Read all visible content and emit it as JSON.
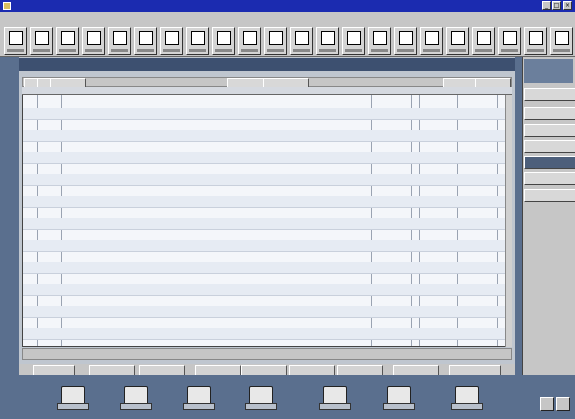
{
  "window": {
    "title": "",
    "min": "_",
    "max": "□",
    "close": "×"
  },
  "menu": [
    "",
    "",
    "",
    "",
    "",
    "",
    ""
  ],
  "toolbar": {
    "buttons": [
      {
        "icon": "new-icon"
      },
      {
        "icon": "open-icon"
      },
      {
        "icon": "register-icon"
      },
      {
        "icon": "write-checks-icon"
      },
      {
        "icon": "reports-icon"
      },
      {
        "icon": "print-icon"
      },
      {
        "icon": "calculator-icon"
      },
      {
        "icon": "bank-icon"
      },
      {
        "icon": "reconcile-icon"
      },
      {
        "icon": "accounts-icon"
      },
      {
        "icon": "invoices-icon"
      },
      {
        "icon": "payments-icon"
      },
      {
        "icon": "deposits-icon"
      },
      {
        "icon": "budget-icon"
      },
      {
        "icon": "graph-icon"
      },
      {
        "icon": "memorized-icon"
      },
      {
        "icon": "export-icon"
      },
      {
        "icon": "help-icon"
      },
      {
        "icon": "options-icon"
      },
      {
        "icon": "setup-icon"
      },
      {
        "icon": "backup-icon"
      },
      {
        "icon": "close-file-icon"
      }
    ]
  },
  "register": {
    "title": "",
    "header_buttons": [
      "",
      "",
      "",
      "",
      "",
      "",
      ""
    ],
    "columns": [
      "",
      "",
      "",
      "",
      "",
      "",
      ""
    ],
    "rows": [
      {
        "date": "",
        "num": "",
        "payee": "",
        "cat": "",
        "pay": "",
        "clr": "",
        "dep": "",
        "bal": ""
      },
      {
        "date": "",
        "num": "",
        "payee": "",
        "cat": "",
        "pay": "",
        "clr": "",
        "dep": "",
        "bal": ""
      },
      {
        "date": "",
        "num": "",
        "payee": "",
        "cat": "",
        "pay": "",
        "clr": "",
        "dep": "",
        "bal": ""
      },
      {
        "date": "",
        "num": "",
        "payee": "",
        "cat": "",
        "pay": "",
        "clr": "",
        "dep": "",
        "bal": ""
      },
      {
        "date": "",
        "num": "",
        "payee": "",
        "cat": "",
        "pay": "",
        "clr": "",
        "dep": "",
        "bal": ""
      },
      {
        "date": "",
        "num": "",
        "payee": "",
        "cat": "",
        "pay": "",
        "clr": "",
        "dep": "",
        "bal": ""
      },
      {
        "date": "",
        "num": "",
        "payee": "",
        "cat": "",
        "pay": "",
        "clr": "",
        "dep": "",
        "bal": ""
      },
      {
        "date": "",
        "num": "",
        "payee": "",
        "cat": "",
        "pay": "",
        "clr": "",
        "dep": "",
        "bal": ""
      },
      {
        "date": "",
        "num": "",
        "payee": "",
        "cat": "",
        "pay": "",
        "clr": "",
        "dep": "",
        "bal": ""
      },
      {
        "date": "",
        "num": "",
        "payee": "",
        "cat": "",
        "pay": "",
        "clr": "",
        "dep": "",
        "bal": ""
      },
      {
        "date": "",
        "num": "",
        "payee": "",
        "cat": "",
        "pay": "",
        "clr": "",
        "dep": "",
        "bal": ""
      },
      {
        "date": "",
        "num": "",
        "payee": "",
        "cat": "",
        "pay": "",
        "clr": "",
        "dep": "",
        "bal": ""
      }
    ],
    "ending_label": "",
    "ending_value": ""
  },
  "account_tabs": [
    "",
    "",
    "",
    "",
    "",
    "",
    "",
    "",
    ""
  ],
  "side_panel": {
    "title": "",
    "buttons": [
      "",
      "",
      "",
      "",
      "",
      "",
      ""
    ]
  },
  "iconbar": [
    {
      "icon": "home-icon"
    },
    {
      "icon": "checks-icon"
    },
    {
      "icon": "accounts-icon"
    },
    {
      "icon": "calendar-icon"
    },
    {
      "icon": "investing-icon"
    },
    {
      "icon": "planning-icon"
    },
    {
      "icon": "help-icon"
    }
  ],
  "colors": {
    "titlebar": "#1b2bb0",
    "doc_title": "#3d5070",
    "background": "#5a6f8e"
  }
}
